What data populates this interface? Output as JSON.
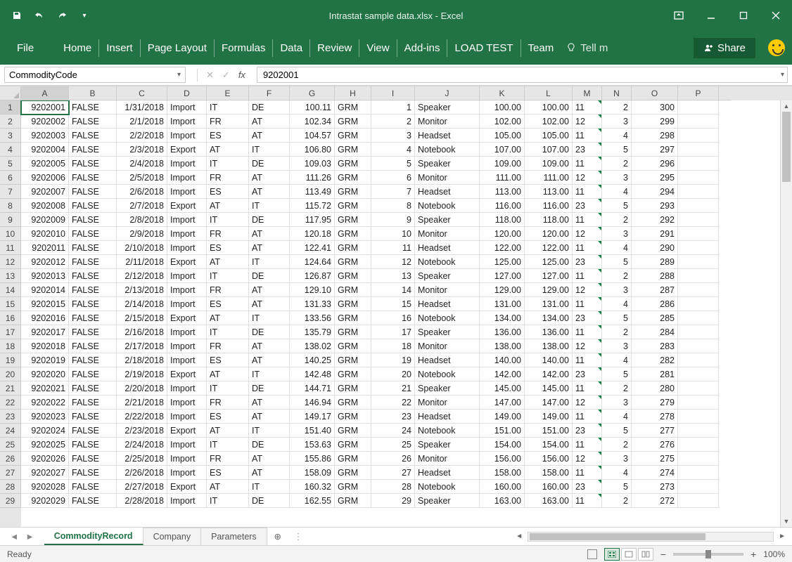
{
  "window": {
    "title": "Intrastat sample data.xlsx - Excel"
  },
  "ribbon": {
    "file": "File",
    "tabs": [
      "Home",
      "Insert",
      "Page Layout",
      "Formulas",
      "Data",
      "Review",
      "View",
      "Add-ins",
      "LOAD TEST",
      "Team"
    ],
    "tell_me": "Tell m",
    "share": "Share"
  },
  "formula_bar": {
    "name_box": "CommodityCode",
    "formula": "9202001"
  },
  "columns": {
    "labels": [
      "A",
      "B",
      "C",
      "D",
      "E",
      "F",
      "G",
      "H",
      "I",
      "J",
      "K",
      "L",
      "M",
      "N",
      "O",
      "P"
    ],
    "widths": [
      68,
      68,
      72,
      56,
      60,
      58,
      64,
      52,
      62,
      92,
      64,
      68,
      42,
      42,
      66,
      58
    ]
  },
  "rows": [
    {
      "n": 1,
      "A": "9202001",
      "B": "FALSE",
      "C": "1/31/2018",
      "D": "Import",
      "E": "IT",
      "F": "DE",
      "G": "100.11",
      "H": "GRM",
      "I": "1",
      "J": "Speaker",
      "K": "100.00",
      "L": "100.00",
      "M": "11",
      "N": "2",
      "O": "300"
    },
    {
      "n": 2,
      "A": "9202002",
      "B": "FALSE",
      "C": "2/1/2018",
      "D": "Import",
      "E": "FR",
      "F": "AT",
      "G": "102.34",
      "H": "GRM",
      "I": "2",
      "J": "Monitor",
      "K": "102.00",
      "L": "102.00",
      "M": "12",
      "N": "3",
      "O": "299"
    },
    {
      "n": 3,
      "A": "9202003",
      "B": "FALSE",
      "C": "2/2/2018",
      "D": "Import",
      "E": "ES",
      "F": "AT",
      "G": "104.57",
      "H": "GRM",
      "I": "3",
      "J": "Headset",
      "K": "105.00",
      "L": "105.00",
      "M": "11",
      "N": "4",
      "O": "298"
    },
    {
      "n": 4,
      "A": "9202004",
      "B": "FALSE",
      "C": "2/3/2018",
      "D": "Export",
      "E": "AT",
      "F": "IT",
      "G": "106.80",
      "H": "GRM",
      "I": "4",
      "J": "Notebook",
      "K": "107.00",
      "L": "107.00",
      "M": "23",
      "N": "5",
      "O": "297"
    },
    {
      "n": 5,
      "A": "9202005",
      "B": "FALSE",
      "C": "2/4/2018",
      "D": "Import",
      "E": "IT",
      "F": "DE",
      "G": "109.03",
      "H": "GRM",
      "I": "5",
      "J": "Speaker",
      "K": "109.00",
      "L": "109.00",
      "M": "11",
      "N": "2",
      "O": "296"
    },
    {
      "n": 6,
      "A": "9202006",
      "B": "FALSE",
      "C": "2/5/2018",
      "D": "Import",
      "E": "FR",
      "F": "AT",
      "G": "111.26",
      "H": "GRM",
      "I": "6",
      "J": "Monitor",
      "K": "111.00",
      "L": "111.00",
      "M": "12",
      "N": "3",
      "O": "295"
    },
    {
      "n": 7,
      "A": "9202007",
      "B": "FALSE",
      "C": "2/6/2018",
      "D": "Import",
      "E": "ES",
      "F": "AT",
      "G": "113.49",
      "H": "GRM",
      "I": "7",
      "J": "Headset",
      "K": "113.00",
      "L": "113.00",
      "M": "11",
      "N": "4",
      "O": "294"
    },
    {
      "n": 8,
      "A": "9202008",
      "B": "FALSE",
      "C": "2/7/2018",
      "D": "Export",
      "E": "AT",
      "F": "IT",
      "G": "115.72",
      "H": "GRM",
      "I": "8",
      "J": "Notebook",
      "K": "116.00",
      "L": "116.00",
      "M": "23",
      "N": "5",
      "O": "293"
    },
    {
      "n": 9,
      "A": "9202009",
      "B": "FALSE",
      "C": "2/8/2018",
      "D": "Import",
      "E": "IT",
      "F": "DE",
      "G": "117.95",
      "H": "GRM",
      "I": "9",
      "J": "Speaker",
      "K": "118.00",
      "L": "118.00",
      "M": "11",
      "N": "2",
      "O": "292"
    },
    {
      "n": 10,
      "A": "9202010",
      "B": "FALSE",
      "C": "2/9/2018",
      "D": "Import",
      "E": "FR",
      "F": "AT",
      "G": "120.18",
      "H": "GRM",
      "I": "10",
      "J": "Monitor",
      "K": "120.00",
      "L": "120.00",
      "M": "12",
      "N": "3",
      "O": "291"
    },
    {
      "n": 11,
      "A": "9202011",
      "B": "FALSE",
      "C": "2/10/2018",
      "D": "Import",
      "E": "ES",
      "F": "AT",
      "G": "122.41",
      "H": "GRM",
      "I": "11",
      "J": "Headset",
      "K": "122.00",
      "L": "122.00",
      "M": "11",
      "N": "4",
      "O": "290"
    },
    {
      "n": 12,
      "A": "9202012",
      "B": "FALSE",
      "C": "2/11/2018",
      "D": "Export",
      "E": "AT",
      "F": "IT",
      "G": "124.64",
      "H": "GRM",
      "I": "12",
      "J": "Notebook",
      "K": "125.00",
      "L": "125.00",
      "M": "23",
      "N": "5",
      "O": "289"
    },
    {
      "n": 13,
      "A": "9202013",
      "B": "FALSE",
      "C": "2/12/2018",
      "D": "Import",
      "E": "IT",
      "F": "DE",
      "G": "126.87",
      "H": "GRM",
      "I": "13",
      "J": "Speaker",
      "K": "127.00",
      "L": "127.00",
      "M": "11",
      "N": "2",
      "O": "288"
    },
    {
      "n": 14,
      "A": "9202014",
      "B": "FALSE",
      "C": "2/13/2018",
      "D": "Import",
      "E": "FR",
      "F": "AT",
      "G": "129.10",
      "H": "GRM",
      "I": "14",
      "J": "Monitor",
      "K": "129.00",
      "L": "129.00",
      "M": "12",
      "N": "3",
      "O": "287"
    },
    {
      "n": 15,
      "A": "9202015",
      "B": "FALSE",
      "C": "2/14/2018",
      "D": "Import",
      "E": "ES",
      "F": "AT",
      "G": "131.33",
      "H": "GRM",
      "I": "15",
      "J": "Headset",
      "K": "131.00",
      "L": "131.00",
      "M": "11",
      "N": "4",
      "O": "286"
    },
    {
      "n": 16,
      "A": "9202016",
      "B": "FALSE",
      "C": "2/15/2018",
      "D": "Export",
      "E": "AT",
      "F": "IT",
      "G": "133.56",
      "H": "GRM",
      "I": "16",
      "J": "Notebook",
      "K": "134.00",
      "L": "134.00",
      "M": "23",
      "N": "5",
      "O": "285"
    },
    {
      "n": 17,
      "A": "9202017",
      "B": "FALSE",
      "C": "2/16/2018",
      "D": "Import",
      "E": "IT",
      "F": "DE",
      "G": "135.79",
      "H": "GRM",
      "I": "17",
      "J": "Speaker",
      "K": "136.00",
      "L": "136.00",
      "M": "11",
      "N": "2",
      "O": "284"
    },
    {
      "n": 18,
      "A": "9202018",
      "B": "FALSE",
      "C": "2/17/2018",
      "D": "Import",
      "E": "FR",
      "F": "AT",
      "G": "138.02",
      "H": "GRM",
      "I": "18",
      "J": "Monitor",
      "K": "138.00",
      "L": "138.00",
      "M": "12",
      "N": "3",
      "O": "283"
    },
    {
      "n": 19,
      "A": "9202019",
      "B": "FALSE",
      "C": "2/18/2018",
      "D": "Import",
      "E": "ES",
      "F": "AT",
      "G": "140.25",
      "H": "GRM",
      "I": "19",
      "J": "Headset",
      "K": "140.00",
      "L": "140.00",
      "M": "11",
      "N": "4",
      "O": "282"
    },
    {
      "n": 20,
      "A": "9202020",
      "B": "FALSE",
      "C": "2/19/2018",
      "D": "Export",
      "E": "AT",
      "F": "IT",
      "G": "142.48",
      "H": "GRM",
      "I": "20",
      "J": "Notebook",
      "K": "142.00",
      "L": "142.00",
      "M": "23",
      "N": "5",
      "O": "281"
    },
    {
      "n": 21,
      "A": "9202021",
      "B": "FALSE",
      "C": "2/20/2018",
      "D": "Import",
      "E": "IT",
      "F": "DE",
      "G": "144.71",
      "H": "GRM",
      "I": "21",
      "J": "Speaker",
      "K": "145.00",
      "L": "145.00",
      "M": "11",
      "N": "2",
      "O": "280"
    },
    {
      "n": 22,
      "A": "9202022",
      "B": "FALSE",
      "C": "2/21/2018",
      "D": "Import",
      "E": "FR",
      "F": "AT",
      "G": "146.94",
      "H": "GRM",
      "I": "22",
      "J": "Monitor",
      "K": "147.00",
      "L": "147.00",
      "M": "12",
      "N": "3",
      "O": "279"
    },
    {
      "n": 23,
      "A": "9202023",
      "B": "FALSE",
      "C": "2/22/2018",
      "D": "Import",
      "E": "ES",
      "F": "AT",
      "G": "149.17",
      "H": "GRM",
      "I": "23",
      "J": "Headset",
      "K": "149.00",
      "L": "149.00",
      "M": "11",
      "N": "4",
      "O": "278"
    },
    {
      "n": 24,
      "A": "9202024",
      "B": "FALSE",
      "C": "2/23/2018",
      "D": "Export",
      "E": "AT",
      "F": "IT",
      "G": "151.40",
      "H": "GRM",
      "I": "24",
      "J": "Notebook",
      "K": "151.00",
      "L": "151.00",
      "M": "23",
      "N": "5",
      "O": "277"
    },
    {
      "n": 25,
      "A": "9202025",
      "B": "FALSE",
      "C": "2/24/2018",
      "D": "Import",
      "E": "IT",
      "F": "DE",
      "G": "153.63",
      "H": "GRM",
      "I": "25",
      "J": "Speaker",
      "K": "154.00",
      "L": "154.00",
      "M": "11",
      "N": "2",
      "O": "276"
    },
    {
      "n": 26,
      "A": "9202026",
      "B": "FALSE",
      "C": "2/25/2018",
      "D": "Import",
      "E": "FR",
      "F": "AT",
      "G": "155.86",
      "H": "GRM",
      "I": "26",
      "J": "Monitor",
      "K": "156.00",
      "L": "156.00",
      "M": "12",
      "N": "3",
      "O": "275"
    },
    {
      "n": 27,
      "A": "9202027",
      "B": "FALSE",
      "C": "2/26/2018",
      "D": "Import",
      "E": "ES",
      "F": "AT",
      "G": "158.09",
      "H": "GRM",
      "I": "27",
      "J": "Headset",
      "K": "158.00",
      "L": "158.00",
      "M": "11",
      "N": "4",
      "O": "274"
    },
    {
      "n": 28,
      "A": "9202028",
      "B": "FALSE",
      "C": "2/27/2018",
      "D": "Export",
      "E": "AT",
      "F": "IT",
      "G": "160.32",
      "H": "GRM",
      "I": "28",
      "J": "Notebook",
      "K": "160.00",
      "L": "160.00",
      "M": "23",
      "N": "5",
      "O": "273"
    },
    {
      "n": 29,
      "A": "9202029",
      "B": "FALSE",
      "C": "2/28/2018",
      "D": "Import",
      "E": "IT",
      "F": "DE",
      "G": "162.55",
      "H": "GRM",
      "I": "29",
      "J": "Speaker",
      "K": "163.00",
      "L": "163.00",
      "M": "11",
      "N": "2",
      "O": "272"
    }
  ],
  "sheets": {
    "tabs": [
      "CommodityRecord",
      "Company",
      "Parameters"
    ],
    "active_index": 0
  },
  "status": {
    "ready": "Ready",
    "zoom": "100%"
  },
  "numeric_columns": [
    "A",
    "C",
    "G",
    "I",
    "K",
    "L",
    "N",
    "O"
  ],
  "green_tick_columns": [
    "M"
  ]
}
